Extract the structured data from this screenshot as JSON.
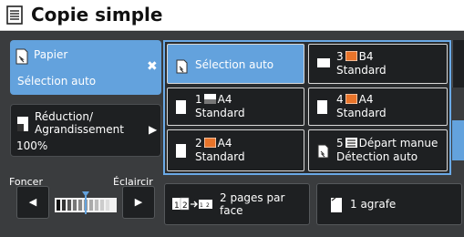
{
  "title": "Copie simple",
  "paper": {
    "label": "Papier",
    "value": "Sélection auto",
    "close_glyph": "✖"
  },
  "reduction": {
    "label_line1": "Réduction/",
    "label_line2": "Agrandissement",
    "value": "100%",
    "arrow_glyph": "▶"
  },
  "density": {
    "left_label": "Foncer",
    "right_label": "Éclaircir",
    "left_arrow": "◀",
    "right_arrow": "▶"
  },
  "trays": [
    {
      "line1": "Sélection auto",
      "line2": ""
    },
    {
      "number": "3",
      "size": "B4",
      "line2": "Standard"
    },
    {
      "number": "1",
      "size": "A4",
      "line2": "Standard"
    },
    {
      "number": "4",
      "size": "A4",
      "line2": "Standard"
    },
    {
      "number": "2",
      "size": "A4",
      "line2": "Standard"
    },
    {
      "number": "5",
      "size": "Départ manue",
      "line2": "Détection auto"
    }
  ],
  "two_pages": {
    "line1": "2 pages par",
    "line2": "face",
    "icon_left": "2",
    "icon_right": "1 2"
  },
  "staple": {
    "label": "1 agrafe"
  },
  "colors": {
    "accent": "#63a2dd",
    "selection_border": "#6aa9e6",
    "tray_orange": "#e8742a",
    "button_bg": "#1e2022"
  }
}
